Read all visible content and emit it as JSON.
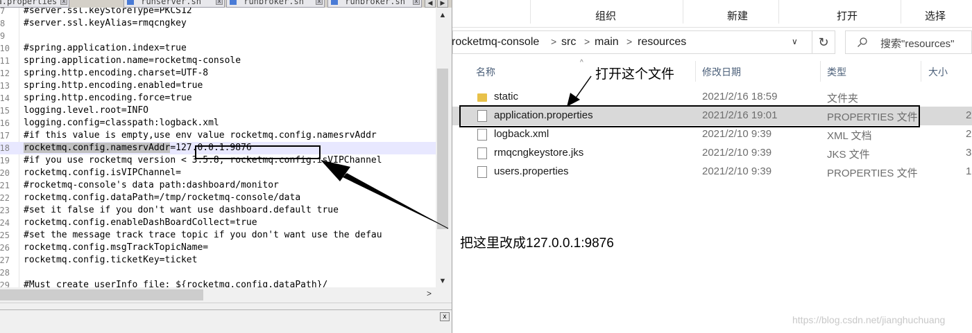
{
  "editor": {
    "tabs": [
      {
        "label": "broker-a.properties"
      },
      {
        "label": "runserver.sh"
      },
      {
        "label": "runbroker.sh"
      },
      {
        "label": "runbroker.sh"
      }
    ],
    "lines": [
      {
        "num": "7",
        "text": "#server.ssl.keyStoreType=PKCS12"
      },
      {
        "num": "8",
        "text": "#server.ssl.keyAlias=rmqcngkey"
      },
      {
        "num": "9",
        "text": ""
      },
      {
        "num": "10",
        "text": "#spring.application.index=true"
      },
      {
        "num": "11",
        "text": "spring.application.name=rocketmq-console"
      },
      {
        "num": "12",
        "text": "spring.http.encoding.charset=UTF-8"
      },
      {
        "num": "13",
        "text": "spring.http.encoding.enabled=true"
      },
      {
        "num": "14",
        "text": "spring.http.encoding.force=true"
      },
      {
        "num": "15",
        "text": "logging.level.root=INFO"
      },
      {
        "num": "16",
        "text": "logging.config=classpath:logback.xml"
      },
      {
        "num": "17",
        "text": "#if this value is empty,use env value rocketmq.config.namesrvAddr"
      },
      {
        "num": "18",
        "text": "rocketmq.config.namesrvAddr=127.0.0.1:9876"
      },
      {
        "num": "19",
        "text": "#if you use rocketmq version < 3.5.8, rocketmq.config.isVIPChannel"
      },
      {
        "num": "20",
        "text": "rocketmq.config.isVIPChannel="
      },
      {
        "num": "21",
        "text": "#rocketmq-console's data path:dashboard/monitor"
      },
      {
        "num": "22",
        "text": "rocketmq.config.dataPath=/tmp/rocketmq-console/data"
      },
      {
        "num": "23",
        "text": "#set it false if you don't want use dashboard.default true"
      },
      {
        "num": "24",
        "text": "rocketmq.config.enableDashBoardCollect=true"
      },
      {
        "num": "25",
        "text": "#set the message track trace topic if you don't want use the defau"
      },
      {
        "num": "26",
        "text": "rocketmq.config.msgTrackTopicName="
      },
      {
        "num": "27",
        "text": "rocketmq.config.ticketKey=ticket"
      },
      {
        "num": "28",
        "text": ""
      },
      {
        "num": "29",
        "text": "#Must create userInfo file: ${rocketmq.config.dataPath}/"
      }
    ],
    "current_line_key": "rocketmq.config.namesrvAddr",
    "current_line_eq": "=",
    "current_line_value": "127.0.0.1:9876"
  },
  "explorer": {
    "ribbon": [
      "组织",
      "新建",
      "打开",
      "选择"
    ],
    "breadcrumb": [
      "rocketmq-console",
      "src",
      "main",
      "resources"
    ],
    "search_placeholder": "搜索\"resources\"",
    "columns": {
      "name": "名称",
      "date": "修改日期",
      "type": "类型",
      "size": "大小"
    },
    "files": [
      {
        "name": "static",
        "date": "2021/2/16 18:59",
        "type": "文件夹",
        "size": "",
        "kind": "folder"
      },
      {
        "name": "application.properties",
        "date": "2021/2/16 19:01",
        "type": "PROPERTIES 文件",
        "size": "2",
        "kind": "file"
      },
      {
        "name": "logback.xml",
        "date": "2021/2/10 9:39",
        "type": "XML 文档",
        "size": "2",
        "kind": "file"
      },
      {
        "name": "rmqcngkeystore.jks",
        "date": "2021/2/10 9:39",
        "type": "JKS 文件",
        "size": "3",
        "kind": "file"
      },
      {
        "name": "users.properties",
        "date": "2021/2/10 9:39",
        "type": "PROPERTIES 文件",
        "size": "1",
        "kind": "file"
      }
    ]
  },
  "annotations": {
    "open_file": "打开这个文件",
    "change_here": "把这里改成127.0.0.1:9876"
  },
  "watermark": "https://blog.csdn.net/jianghuchuang",
  "colors": {
    "selection": "#d9d9d9",
    "current_line": "#e8e8ff",
    "folder": "#e8c14a"
  }
}
